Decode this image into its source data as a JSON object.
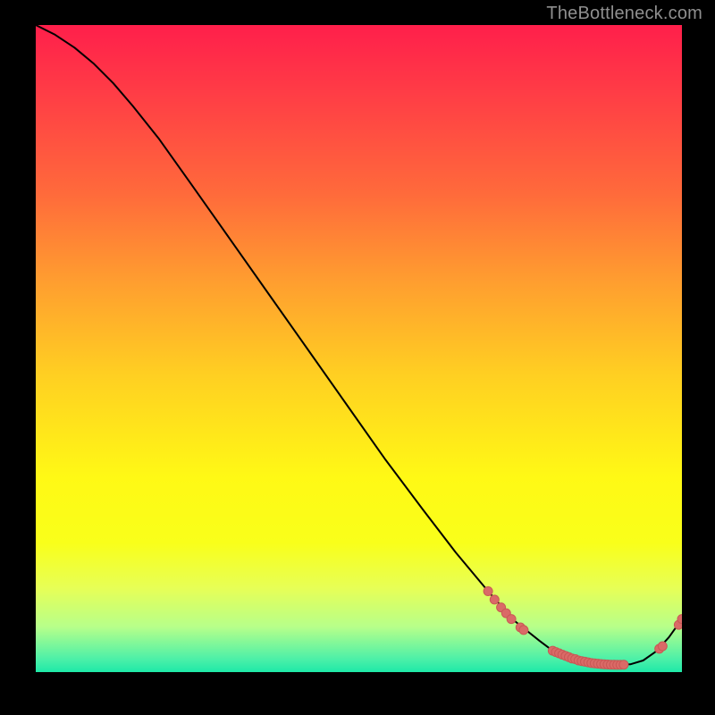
{
  "attribution": "TheBottleneck.com",
  "colors": {
    "page_bg": "#000000",
    "curve_stroke": "#000000",
    "marker_fill": "#da6a67",
    "marker_stroke": "#c95855"
  },
  "chart_data": {
    "type": "line",
    "title": "",
    "xlabel": "",
    "ylabel": "",
    "xlim": [
      0,
      100
    ],
    "ylim": [
      0,
      100
    ],
    "grid": false,
    "legend": false,
    "series": [
      {
        "name": "bottleneck-curve",
        "x": [
          0,
          3,
          6,
          9,
          12,
          15,
          19,
          24,
          30,
          36,
          42,
          48,
          54,
          60,
          65,
          70,
          74,
          78,
          80,
          82,
          84,
          86,
          88,
          90,
          92,
          94,
          96,
          98,
          100
        ],
        "y": [
          100,
          98.5,
          96.5,
          94,
          91,
          87.5,
          82.5,
          75.5,
          67,
          58.5,
          50,
          41.5,
          33,
          25,
          18.5,
          12.5,
          8,
          4.8,
          3.3,
          2.4,
          1.8,
          1.4,
          1.2,
          1.1,
          1.2,
          1.8,
          3.2,
          5.4,
          8.2
        ]
      }
    ],
    "markers": [
      {
        "x": 70.0,
        "y": 12.5
      },
      {
        "x": 71.0,
        "y": 11.2
      },
      {
        "x": 72.0,
        "y": 10.0
      },
      {
        "x": 72.8,
        "y": 9.1
      },
      {
        "x": 73.6,
        "y": 8.2
      },
      {
        "x": 75.0,
        "y": 6.9
      },
      {
        "x": 75.5,
        "y": 6.5
      },
      {
        "x": 80.0,
        "y": 3.3
      },
      {
        "x": 80.5,
        "y": 3.1
      },
      {
        "x": 81.0,
        "y": 2.9
      },
      {
        "x": 81.5,
        "y": 2.7
      },
      {
        "x": 82.0,
        "y": 2.5
      },
      {
        "x": 82.5,
        "y": 2.3
      },
      {
        "x": 83.0,
        "y": 2.1
      },
      {
        "x": 83.5,
        "y": 2.0
      },
      {
        "x": 84.0,
        "y": 1.8
      },
      {
        "x": 84.5,
        "y": 1.7
      },
      {
        "x": 85.0,
        "y": 1.6
      },
      {
        "x": 85.5,
        "y": 1.5
      },
      {
        "x": 86.0,
        "y": 1.4
      },
      {
        "x": 86.5,
        "y": 1.35
      },
      {
        "x": 87.0,
        "y": 1.3
      },
      {
        "x": 87.5,
        "y": 1.25
      },
      {
        "x": 88.0,
        "y": 1.2
      },
      {
        "x": 88.5,
        "y": 1.18
      },
      {
        "x": 89.0,
        "y": 1.15
      },
      {
        "x": 89.5,
        "y": 1.13
      },
      {
        "x": 90.0,
        "y": 1.12
      },
      {
        "x": 90.5,
        "y": 1.12
      },
      {
        "x": 91.0,
        "y": 1.15
      },
      {
        "x": 96.5,
        "y": 3.6
      },
      {
        "x": 97.0,
        "y": 4.0
      },
      {
        "x": 99.5,
        "y": 7.3
      },
      {
        "x": 100.0,
        "y": 8.2
      }
    ]
  }
}
